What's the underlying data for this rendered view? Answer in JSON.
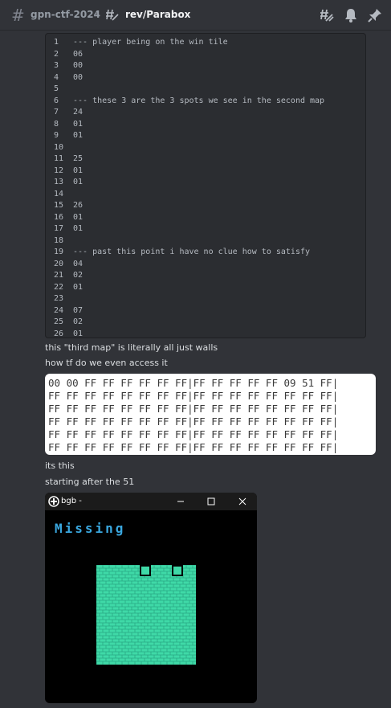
{
  "header": {
    "server": "gpn-ctf-2024",
    "separator": "›",
    "thread": "rev/Parabox"
  },
  "code_lines": [
    {
      "n": "1",
      "t": "--- player being on the win tile"
    },
    {
      "n": "2",
      "t": "06"
    },
    {
      "n": "3",
      "t": "00"
    },
    {
      "n": "4",
      "t": "00"
    },
    {
      "n": "5",
      "t": ""
    },
    {
      "n": "6",
      "t": "--- these 3 are the 3 spots we see in the second map"
    },
    {
      "n": "7",
      "t": "24"
    },
    {
      "n": "8",
      "t": "01"
    },
    {
      "n": "9",
      "t": "01"
    },
    {
      "n": "10",
      "t": ""
    },
    {
      "n": "11",
      "t": "25"
    },
    {
      "n": "12",
      "t": "01"
    },
    {
      "n": "13",
      "t": "01"
    },
    {
      "n": "14",
      "t": ""
    },
    {
      "n": "15",
      "t": "26"
    },
    {
      "n": "16",
      "t": "01"
    },
    {
      "n": "17",
      "t": "01"
    },
    {
      "n": "18",
      "t": ""
    },
    {
      "n": "19",
      "t": "--- past this point i have no clue how to satisfy"
    },
    {
      "n": "20",
      "t": "04"
    },
    {
      "n": "21",
      "t": "02"
    },
    {
      "n": "22",
      "t": "01"
    },
    {
      "n": "23",
      "t": ""
    },
    {
      "n": "24",
      "t": "07"
    },
    {
      "n": "25",
      "t": "02"
    },
    {
      "n": "26",
      "t": "01"
    }
  ],
  "messages": {
    "m1": "this \"third map\" is literally all just walls",
    "m2": "how tf do we even access it",
    "m3": "its this",
    "m4": "starting after the 51"
  },
  "hex_rows": [
    "00 00 FF FF FF FF FF FF|FF FF FF FF FF 09 51 FF|",
    "FF FF FF FF FF FF FF FF|FF FF FF FF FF FF FF FF|",
    "FF FF FF FF FF FF FF FF|FF FF FF FF FF FF FF FF|",
    "FF FF FF FF FF FF FF FF|FF FF FF FF FF FF FF FF|",
    "FF FF FF FF FF FF FF FF|FF FF FF FF FF FF FF FF|",
    "FF FF FF FF FF FF FF FF|FF FF FF FF FF FF FF FF|"
  ],
  "emulator": {
    "title": "bgb -",
    "screen_text": "Missing",
    "wall_color": "#3fd9a7"
  },
  "colors": {
    "background": "#313338",
    "code_bg": "#2b2d31"
  }
}
